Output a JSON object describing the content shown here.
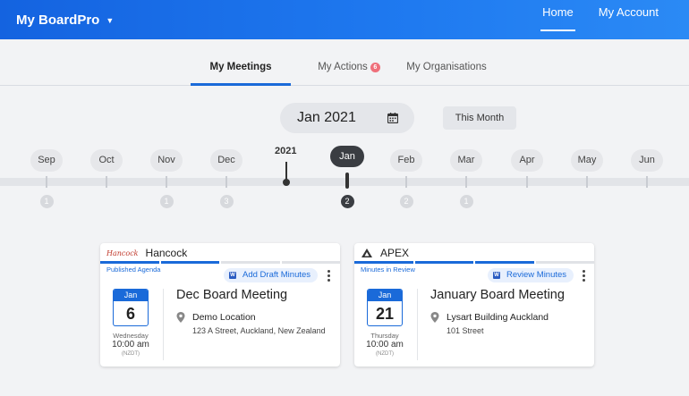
{
  "header": {
    "app_name": "My BoardPro",
    "nav": [
      {
        "label": "Home",
        "active": true
      },
      {
        "label": "My Account",
        "active": false
      }
    ]
  },
  "tabs": [
    {
      "label": "My Meetings",
      "active": true
    },
    {
      "label": "My Actions",
      "badge": "6"
    },
    {
      "label": "My Organisations"
    }
  ],
  "date_picker": {
    "value": "Jan 2021",
    "icon": "calendar-icon"
  },
  "this_month_label": "This Month",
  "timeline": {
    "year_label": "2021",
    "months": [
      {
        "label": "Sep",
        "count": "1"
      },
      {
        "label": "Oct",
        "count": ""
      },
      {
        "label": "Nov",
        "count": "1"
      },
      {
        "label": "Dec",
        "count": "3"
      },
      {
        "label": "Jan",
        "count": "2",
        "current": true
      },
      {
        "label": "Feb",
        "count": "2"
      },
      {
        "label": "Mar",
        "count": "1"
      },
      {
        "label": "Apr",
        "count": ""
      },
      {
        "label": "May",
        "count": ""
      },
      {
        "label": "Jun",
        "count": ""
      }
    ]
  },
  "meetings": [
    {
      "org": "Hancock",
      "logo_text": "Hancock",
      "status": "Published Agenda",
      "action": "Add Draft Minutes",
      "month": "Jan",
      "day": "6",
      "weekday": "Wednesday",
      "time": "10:00 am",
      "timezone": "(NZDT)",
      "title": "Dec Board Meeting",
      "location": "Demo Location",
      "address": "123 A Street, Auckland, New Zealand",
      "progress_steps_done": 2,
      "progress_steps_total": 4
    },
    {
      "org": "APEX",
      "logo_text": "APEX",
      "status": "Minutes in Review",
      "action": "Review Minutes",
      "month": "Jan",
      "day": "21",
      "weekday": "Thursday",
      "time": "10:00 am",
      "timezone": "(NZDT)",
      "title": "January Board Meeting",
      "location": "Lysart Building Auckland",
      "address": "101 Street",
      "progress_steps_done": 3,
      "progress_steps_total": 4
    }
  ],
  "colors": {
    "accent": "#1a6ad9",
    "badge": "#ef6f7a",
    "header_start": "#1463e0"
  }
}
